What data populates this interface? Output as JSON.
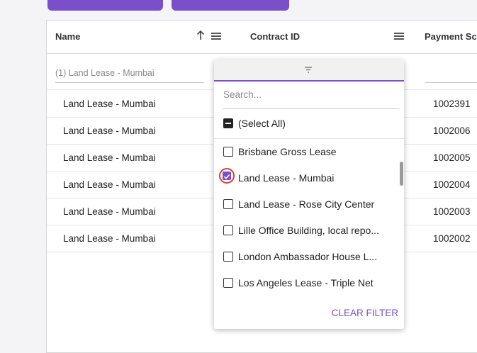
{
  "columns": {
    "name": "Name",
    "contract_id": "Contract ID",
    "payment": "Payment Sc"
  },
  "name_filter_value": "(1) Land Lease - Mumbai",
  "rows": [
    {
      "name": "Land Lease - Mumbai",
      "id": "1002391"
    },
    {
      "name": "Land Lease - Mumbai",
      "id": "1002006"
    },
    {
      "name": "Land Lease - Mumbai",
      "id": "1002005"
    },
    {
      "name": "Land Lease - Mumbai",
      "id": "1002004"
    },
    {
      "name": "Land Lease - Mumbai",
      "id": "1002003"
    },
    {
      "name": "Land Lease - Mumbai",
      "id": "1002002"
    }
  ],
  "filter_popup": {
    "search_placeholder": "Search...",
    "select_all": "(Select All)",
    "options": [
      {
        "label": "Brisbane Gross Lease",
        "checked": false
      },
      {
        "label": "Land Lease - Mumbai",
        "checked": true
      },
      {
        "label": "Land Lease - Rose City Center",
        "checked": false
      },
      {
        "label": "Lille Office Building, local repo...",
        "checked": false
      },
      {
        "label": "London Ambassador House L...",
        "checked": false
      },
      {
        "label": "Los Angeles Lease - Triple Net",
        "checked": false
      }
    ],
    "clear_label": "CLEAR FILTER"
  },
  "colors": {
    "accent": "#7b4fc9",
    "highlight": "#e53935"
  }
}
